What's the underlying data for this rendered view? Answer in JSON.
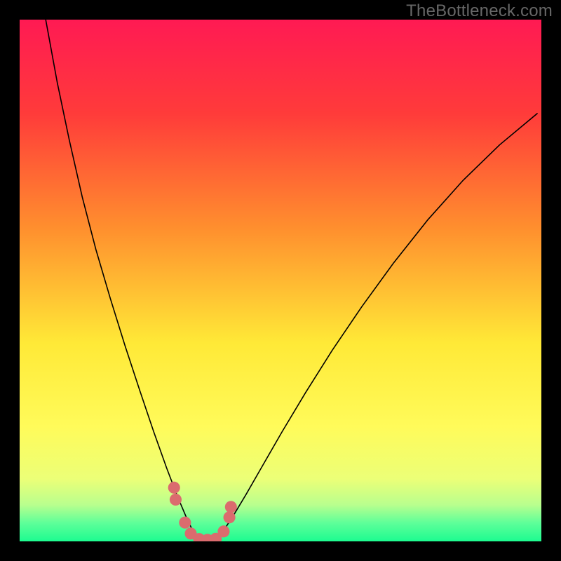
{
  "watermark": "TheBottleneck.com",
  "chart_data": {
    "type": "line",
    "title": "",
    "xlabel": "",
    "ylabel": "",
    "xlim": [
      0,
      100
    ],
    "ylim": [
      0,
      100
    ],
    "gradient_stops": [
      {
        "offset": 0.0,
        "color": "#ff1a53"
      },
      {
        "offset": 0.18,
        "color": "#ff3b3a"
      },
      {
        "offset": 0.4,
        "color": "#ff8f2e"
      },
      {
        "offset": 0.62,
        "color": "#ffe937"
      },
      {
        "offset": 0.78,
        "color": "#fffb5a"
      },
      {
        "offset": 0.88,
        "color": "#ecff77"
      },
      {
        "offset": 0.93,
        "color": "#b9ff8e"
      },
      {
        "offset": 0.965,
        "color": "#5dff99"
      },
      {
        "offset": 1.0,
        "color": "#1dfb90"
      }
    ],
    "series": [
      {
        "name": "curve-left",
        "color": "#000000",
        "x": [
          5.0,
          7.2,
          9.5,
          12.0,
          14.6,
          17.4,
          20.2,
          23.0,
          25.7,
          28.2,
          30.3,
          32.0,
          33.2,
          34.0,
          34.5
        ],
        "y": [
          100.0,
          88.0,
          77.0,
          66.0,
          56.0,
          46.5,
          37.5,
          29.0,
          21.0,
          14.0,
          8.5,
          4.5,
          2.0,
          0.7,
          0.2
        ]
      },
      {
        "name": "curve-right",
        "color": "#000000",
        "x": [
          37.5,
          38.2,
          39.3,
          41.0,
          43.4,
          46.5,
          50.3,
          54.8,
          59.9,
          65.6,
          71.7,
          78.2,
          85.0,
          92.0,
          99.2
        ],
        "y": [
          0.2,
          0.9,
          2.4,
          5.0,
          9.0,
          14.4,
          21.0,
          28.5,
          36.6,
          45.0,
          53.4,
          61.6,
          69.2,
          76.0,
          82.0
        ]
      }
    ],
    "valley_points": {
      "color": "#db6b6e",
      "radius": 1.15,
      "points": [
        {
          "x": 29.6,
          "y": 10.3
        },
        {
          "x": 29.9,
          "y": 8.0
        },
        {
          "x": 31.7,
          "y": 3.6
        },
        {
          "x": 32.8,
          "y": 1.5
        },
        {
          "x": 34.4,
          "y": 0.45
        },
        {
          "x": 36.0,
          "y": 0.3
        },
        {
          "x": 37.6,
          "y": 0.5
        },
        {
          "x": 39.1,
          "y": 1.9
        },
        {
          "x": 40.2,
          "y": 4.6
        },
        {
          "x": 40.5,
          "y": 6.6
        }
      ]
    }
  }
}
